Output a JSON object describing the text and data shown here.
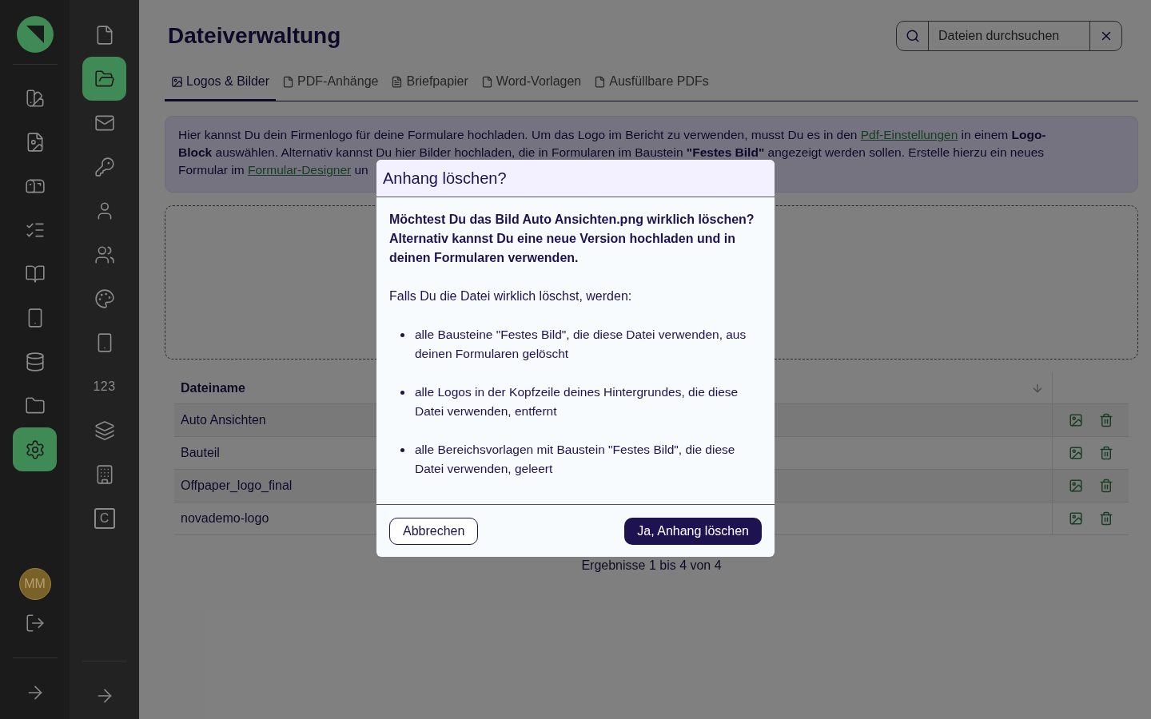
{
  "nav_primary": {
    "items": [
      {
        "selected": false
      },
      {
        "selected": false
      },
      {
        "selected": false
      },
      {
        "selected": false
      },
      {
        "selected": false
      },
      {
        "selected": false
      },
      {
        "selected": false
      },
      {
        "selected": false
      },
      {
        "selected": true
      }
    ],
    "avatar": "MM"
  },
  "nav_secondary": {
    "items": [
      {
        "kind": "icon",
        "selected": false
      },
      {
        "kind": "icon",
        "selected": true
      },
      {
        "kind": "icon",
        "selected": false
      },
      {
        "kind": "icon",
        "selected": false
      },
      {
        "kind": "icon",
        "selected": false
      },
      {
        "kind": "icon",
        "selected": false
      },
      {
        "kind": "icon",
        "selected": false
      },
      {
        "kind": "icon",
        "selected": false
      },
      {
        "kind": "text",
        "label": "123",
        "selected": false
      },
      {
        "kind": "icon",
        "selected": false
      },
      {
        "kind": "icon",
        "selected": false
      },
      {
        "kind": "boxed",
        "label": "C",
        "selected": false
      }
    ]
  },
  "page": {
    "title": "Dateiverwaltung",
    "search": {
      "placeholder": "Dateien durchsuchen"
    }
  },
  "tabs": [
    {
      "label": "Logos & Bilder",
      "selected": true
    },
    {
      "label": "PDF-Anhänge",
      "selected": false
    },
    {
      "label": "Briefpapier",
      "selected": false
    },
    {
      "label": "Word-Vorlagen",
      "selected": false
    },
    {
      "label": "Ausfüllbare PDFs",
      "selected": false
    }
  ],
  "info": [
    [
      {
        "kind": "text",
        "text": "Hier kannst Du dein Firmenlogo für deine Formulare hochladen. Um das Logo im Bericht zu verwenden, musst Du es in den "
      },
      {
        "kind": "link",
        "text": "Pdf-Einstellungen"
      },
      {
        "kind": "text",
        "text": " in einem "
      },
      {
        "kind": "bold",
        "text": "Logo-"
      }
    ],
    [
      {
        "kind": "bold",
        "text": "Block"
      },
      {
        "kind": "text",
        "text": " auswählen. Alternativ kannst Du hier Bilder hochladen, die in Formularen im Baustein "
      },
      {
        "kind": "bold",
        "text": "\"Festes Bild\""
      },
      {
        "kind": "text",
        "text": " angezeigt werden sollen. Erstelle hierzu ein neues"
      }
    ],
    [
      {
        "kind": "text",
        "text": "Formular im "
      },
      {
        "kind": "link",
        "text": "Formular-Designer"
      },
      {
        "kind": "text",
        "text": " un"
      }
    ]
  ],
  "table": {
    "columns": [
      "Dateiname"
    ],
    "rows": [
      {
        "name": "Auto Ansichten"
      },
      {
        "name": "Bauteil"
      },
      {
        "name": "Offpaper_logo_final"
      },
      {
        "name": "novademo-logo"
      }
    ],
    "summary": "Ergebnisse 1 bis 4 von 4"
  },
  "dialog": {
    "title": "Anhang löschen?",
    "question": "Möchtest Du das Bild Auto Ansichten.png wirklich löschen? Alternativ kannst Du eine neue Version hochladen und in deinen Formularen verwenden.",
    "lead": "Falls Du die Datei wirklich löschst, werden:",
    "consequences": [
      "alle Bausteine \"Festes Bild\", die diese Datei verwenden, aus deinen Formularen gelöscht",
      "alle Logos in der Kopfzeile deines Hintergrundes, die diese Datei verwenden, entfernt",
      "alle Bereichsvorlagen mit Baustein \"Festes Bild\", die diese Datei verwenden, geleert"
    ],
    "buttons": [
      {
        "kind": "secondary",
        "label": "Abbrechen"
      },
      {
        "kind": "primary",
        "label": "Ja, Anhang löschen"
      }
    ]
  }
}
